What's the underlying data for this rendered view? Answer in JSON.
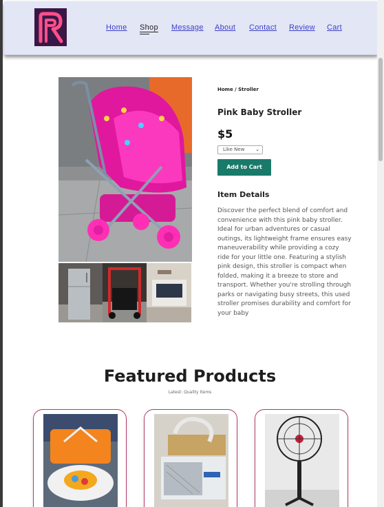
{
  "nav": {
    "items": [
      {
        "label": "Home",
        "active": false
      },
      {
        "label": "Shop",
        "active": true
      },
      {
        "label": "Message",
        "active": false
      },
      {
        "label": "About",
        "active": false
      },
      {
        "label": "Contact",
        "active": false
      },
      {
        "label": "Review",
        "active": false
      },
      {
        "label": "Cart",
        "active": false
      }
    ]
  },
  "product": {
    "breadcrumb": "Home / Stroller",
    "title": "Pink Baby Stroller",
    "price": "$5",
    "condition": "Like New",
    "add_to_cart": "Add to Cart",
    "details_heading": "Item Details",
    "description": "Discover the perfect blend of comfort and convenience with this pink baby stroller. Ideal for urban adventures or casual outings, its lightweight frame ensures easy maneuverability while providing a cozy ride for your little one. Featuring a stylish pink design, this stroller is compact when folded, making it a breeze to store and transport. Whether you're strolling through parks or navigating busy streets, this used stroller promises durability and comfort for your baby"
  },
  "featured": {
    "heading": "Featured Products",
    "subheading": "Latest: Quality Items"
  },
  "colors": {
    "header_bg": "#e3e6f5",
    "nav_link": "#3c3ec9",
    "logo_bg": "#3b1746",
    "logo_mark": "#ff4f8b",
    "cart_button": "#1a7a6a",
    "card_border": "#b33b6b"
  }
}
